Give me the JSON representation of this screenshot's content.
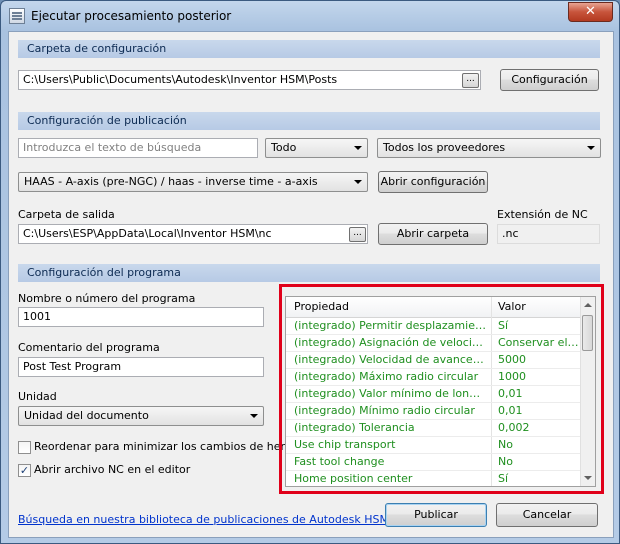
{
  "window": {
    "title": "Ejecutar procesamiento posterior",
    "close_glyph": "✕"
  },
  "config_folder": {
    "heading": "Carpeta de configuración",
    "path": "C:\\Users\\Public\\Documents\\Autodesk\\Inventor HSM\\Posts",
    "browse_label": "...",
    "button_label": "Configuración"
  },
  "publication": {
    "heading": "Configuración de publicación",
    "search_placeholder": "Introduzca el texto de búsqueda",
    "filter_value": "Todo",
    "vendor_value": "Todos los proveedores",
    "post_value": "HAAS - A-axis (pre-NGC) / haas - inverse time - a-axis",
    "open_config_label": "Abrir configuración"
  },
  "output": {
    "folder_label": "Carpeta de salida",
    "folder_path": "C:\\Users\\ESP\\AppData\\Local\\Inventor HSM\\nc",
    "browse_label": "...",
    "open_folder_label": "Abrir carpeta",
    "extension_label": "Extensión de NC",
    "extension_value": ".nc"
  },
  "program": {
    "heading": "Configuración del programa",
    "name_label": "Nombre o número del programa",
    "name_value": "1001",
    "comment_label": "Comentario del programa",
    "comment_value": "Post Test Program",
    "unit_label": "Unidad",
    "unit_value": "Unidad del documento",
    "reorder_label": "Reordenar para minimizar los cambios de herrami",
    "reorder_checked": false,
    "open_nc_label": "Abrir archivo NC en el editor",
    "open_nc_checked": true,
    "check_glyph": "✓"
  },
  "properties": {
    "col_property": "Propiedad",
    "col_value": "Valor",
    "rows": [
      {
        "property": "(integrado) Permitir desplazamientos he...",
        "value": "Sí"
      },
      {
        "property": "(integrado) Asignación de velocidad de ...",
        "value": "Conservar el ..."
      },
      {
        "property": "(integrado) Velocidad de avance alta",
        "value": "5000"
      },
      {
        "property": "(integrado) Máximo radio circular",
        "value": "1000"
      },
      {
        "property": "(integrado) Valor mínimo de longitud de ...",
        "value": "0,01"
      },
      {
        "property": "(integrado) Mínimo radio circular",
        "value": "0,01"
      },
      {
        "property": "(integrado) Tolerancia",
        "value": "0,002"
      },
      {
        "property": "Use chip transport",
        "value": "No"
      },
      {
        "property": "Fast tool change",
        "value": "No"
      },
      {
        "property": "Home position center",
        "value": "Sí"
      }
    ],
    "text_color": "#1f8f1f",
    "highlight_color": "#e0001a"
  },
  "footer": {
    "link_text": "Búsqueda en nuestra biblioteca de publicaciones de Autodesk HSM",
    "publish_label": "Publicar",
    "cancel_label": "Cancelar"
  }
}
